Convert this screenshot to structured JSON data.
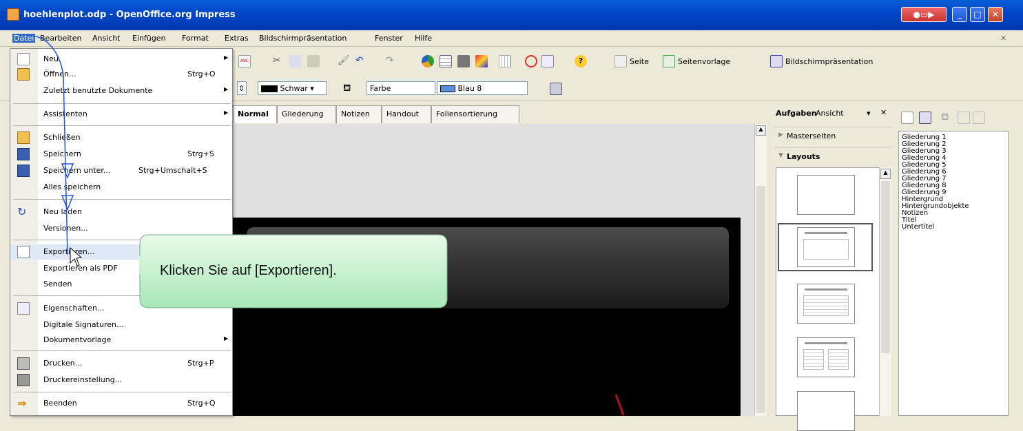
{
  "window": {
    "title": "hoehlenplot.odp - OpenOffice.org Impress"
  },
  "menubar": [
    "Datei",
    "Bearbeiten",
    "Ansicht",
    "Einfügen",
    "Format",
    "Extras",
    "Bildschirmpräsentation",
    "Fenster",
    "Hilfe"
  ],
  "toolbar": {
    "seite": "Seite",
    "seitenvorlage": "Seitenvorlage",
    "bildschirmpraesentation": "Bildschirmpräsentation"
  },
  "formatbar": {
    "line_color": "Schwar",
    "fill_type": "Farbe",
    "fill_color": "Blau 8"
  },
  "view_tabs": [
    "Normal",
    "Gliederung",
    "Notizen",
    "Handout",
    "Foliensortierung"
  ],
  "taskpane": {
    "title": "Aufgaben",
    "view": "Ansicht",
    "master": "Masterseiten",
    "layouts": "Layouts"
  },
  "styles": [
    "Gliederung 1",
    "Gliederung 2",
    "Gliederung 3",
    "Gliederung 4",
    "Gliederung 5",
    "Gliederung 6",
    "Gliederung 7",
    "Gliederung 8",
    "Gliederung 9",
    "Hintergrund",
    "Hintergrundobjekte",
    "Notizen",
    "Titel",
    "Untertitel"
  ],
  "file_menu": {
    "neu": "Neu",
    "oeffnen": "Öffnen...",
    "oeffnen_sc": "Strg+O",
    "zuletzt": "Zuletzt benutzte Dokumente",
    "assistenten": "Assistenten",
    "schliessen": "Schließen",
    "speichern": "Speichern",
    "speichern_sc": "Strg+S",
    "speichern_unter": "Speichern unter...",
    "speichern_unter_sc": "Strg+Umschalt+S",
    "alle_speichern": "Alles speichern",
    "neu_laden": "Neu laden",
    "versionen": "Versionen...",
    "exportieren": "Exportieren...",
    "exportieren_pdf": "Exportieren als PDF",
    "senden": "Senden",
    "eigenschaften": "Eigenschaften...",
    "signaturen": "Digitale Signaturen...",
    "dokumentvorlage": "Dokumentvorlage",
    "drucken": "Drucken...",
    "drucken_sc": "Strg+P",
    "druckereinstellung": "Druckereinstellung...",
    "beenden": "Beenden",
    "beenden_sc": "Strg+Q"
  },
  "callout": {
    "text": "Klicken Sie auf [Exportieren]."
  }
}
